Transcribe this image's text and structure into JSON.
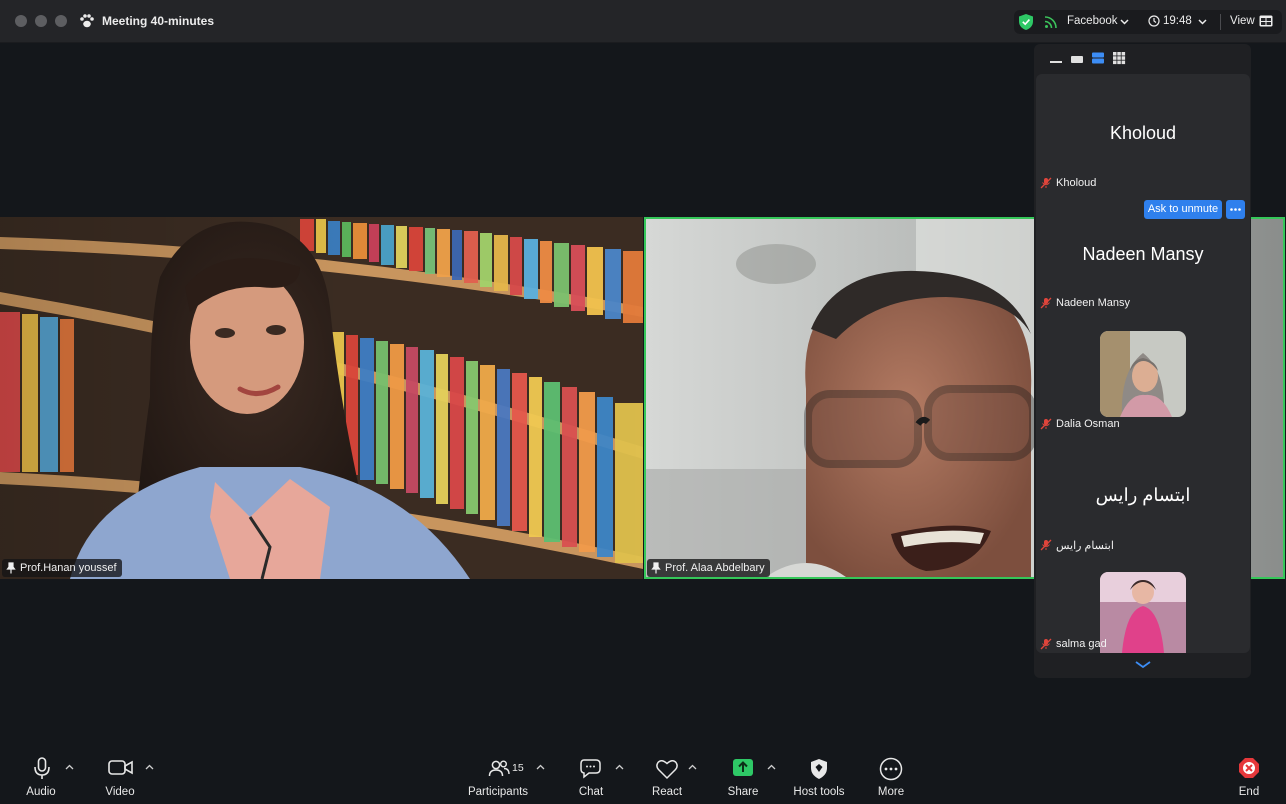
{
  "window": {
    "title": "Meeting  40-minutes",
    "status": {
      "source_label": "Facebook",
      "time": "19:48",
      "view_label": "View"
    }
  },
  "videos": [
    {
      "name": "Prof.Hanan youssef",
      "active": false
    },
    {
      "name": "Prof. Alaa Abdelbary",
      "active": true
    }
  ],
  "panel": {
    "participants": [
      {
        "display": "Kholoud",
        "label": "Kholoud",
        "muted": true,
        "has_photo": false
      },
      {
        "display": "Nadeen Mansy",
        "label": "Nadeen Mansy",
        "muted": true,
        "has_photo": false
      },
      {
        "display": "",
        "label": "Dalia Osman",
        "muted": true,
        "has_photo": true
      },
      {
        "display": "ابتسام رايس",
        "label": "ابتسام رايس",
        "muted": true,
        "has_photo": false
      },
      {
        "display": "",
        "label": "salma gad",
        "muted": true,
        "has_photo": true
      }
    ],
    "ask_to_unmute": "Ask to unmute"
  },
  "toolbar": {
    "audio": "Audio",
    "video": "Video",
    "participants": "Participants",
    "participants_count": "15",
    "chat": "Chat",
    "react": "React",
    "share": "Share",
    "host_tools": "Host tools",
    "more": "More",
    "end": "End"
  },
  "colors": {
    "active_speaker_border": "#35c759",
    "share_green": "#2ec866",
    "end_red": "#e5383b",
    "accent_blue": "#2f80ed",
    "mute_red": "#e0453b"
  }
}
